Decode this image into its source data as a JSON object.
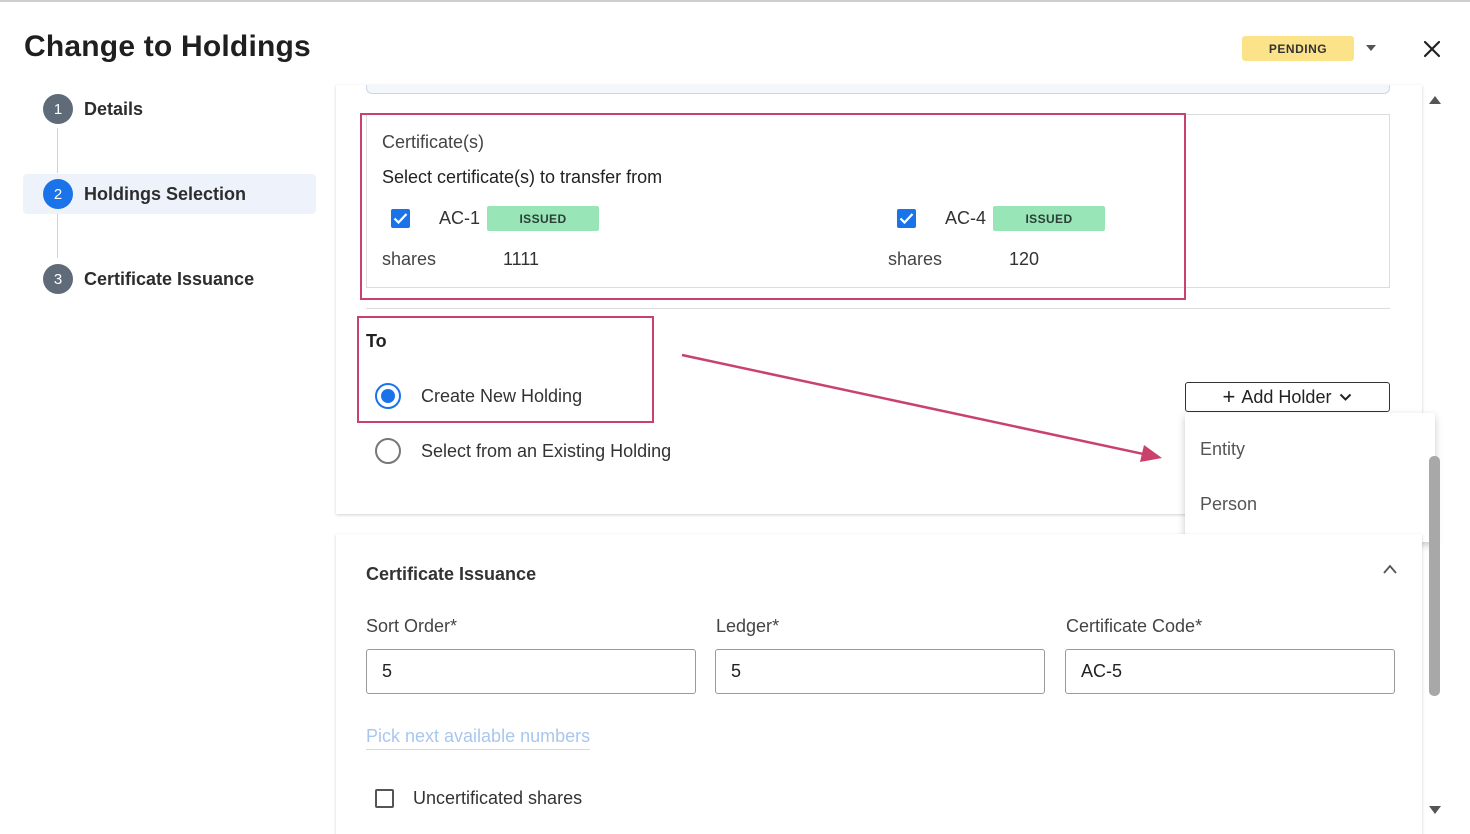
{
  "dialog": {
    "title": "Change to Holdings",
    "status": "PENDING"
  },
  "stepper": {
    "steps": [
      {
        "num": "1",
        "label": "Details"
      },
      {
        "num": "2",
        "label": "Holdings Selection"
      },
      {
        "num": "3",
        "label": "Certificate Issuance"
      }
    ]
  },
  "certificates": {
    "heading": "Certificate(s)",
    "subheading": "Select certificate(s) to transfer from",
    "items": [
      {
        "code": "AC-1",
        "status": "ISSUED",
        "shares_label": "shares",
        "shares": "1111"
      },
      {
        "code": "AC-4",
        "status": "ISSUED",
        "shares_label": "shares",
        "shares": "120"
      }
    ]
  },
  "to": {
    "label": "To",
    "options": [
      {
        "label": "Create New Holding"
      },
      {
        "label": "Select from an Existing Holding"
      }
    ],
    "add_holder": "Add Holder",
    "menu": [
      "Entity",
      "Person"
    ]
  },
  "issuance": {
    "title": "Certificate Issuance",
    "sort_order_label": "Sort Order",
    "sort_order_value": "5",
    "ledger_label": "Ledger",
    "ledger_value": "5",
    "code_label": "Certificate Code",
    "code_value": "AC-5",
    "required_mark": "*",
    "pick_link": "Pick next available numbers",
    "uncertificated_label": "Uncertificated shares"
  },
  "colors": {
    "accent": "#1a73e8",
    "pending_badge": "#fce38a",
    "issued_badge": "#98e6b8",
    "annotation": "#c9426c"
  }
}
